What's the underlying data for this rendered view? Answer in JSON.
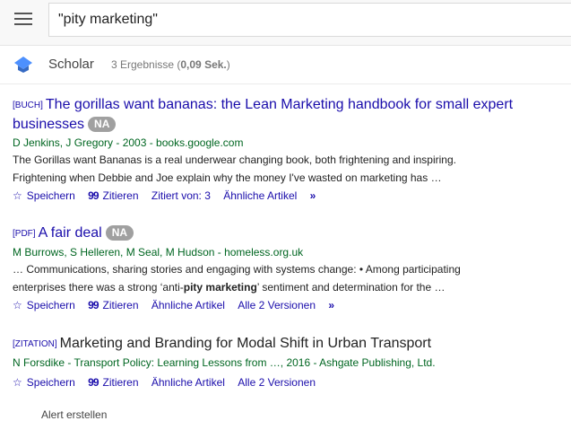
{
  "search": {
    "query": "\"pity marketing\""
  },
  "scholar": {
    "label": "Scholar",
    "count_prefix": "3 Ergebnisse (",
    "count_time": "0,09 Sek.",
    "count_suffix": ")"
  },
  "results": [
    {
      "tag": "[BUCH]",
      "title": "The gorillas want bananas: the Lean Marketing handbook for small expert businesses",
      "badge": "NA",
      "authors": "D Jenkins, J Gregory - 2003 - books.google.com",
      "snippet1": "The Gorillas want Bananas is a real underwear changing book, both frightening and inspiring.",
      "snippet2": "Frightening when Debbie and Joe explain why the money I've wasted on marketing has …",
      "links": [
        "Speichern",
        "Zitieren",
        "Zitiert von: 3",
        "Ähnliche Artikel"
      ]
    },
    {
      "tag": "[PDF]",
      "title": "A fair deal",
      "badge": "NA",
      "authors": "M Burrows, S Helleren, M Seal, M Hudson - homeless.org.uk",
      "snippet1": "… Communications, sharing stories and engaging with systems change: • Among participating",
      "snippet2_pre": "enterprises there was a strong ‘anti-",
      "snippet2_bold": "pity marketing",
      "snippet2_post": "’ sentiment and determination for the …",
      "links": [
        "Speichern",
        "Zitieren",
        "Ähnliche Artikel",
        "Alle 2 Versionen"
      ]
    },
    {
      "tag": "[ZITATION]",
      "title": "Marketing and Branding for Modal Shift in Urban Transport",
      "authors": "N Forsdike - Transport Policy: Learning Lessons from …, 2016 - Ashgate Publishing, Ltd.",
      "links": [
        "Speichern",
        "Zitieren",
        "Ähnliche Artikel",
        "Alle 2 Versionen"
      ]
    }
  ],
  "footer": {
    "text": "Alert erstellen"
  }
}
